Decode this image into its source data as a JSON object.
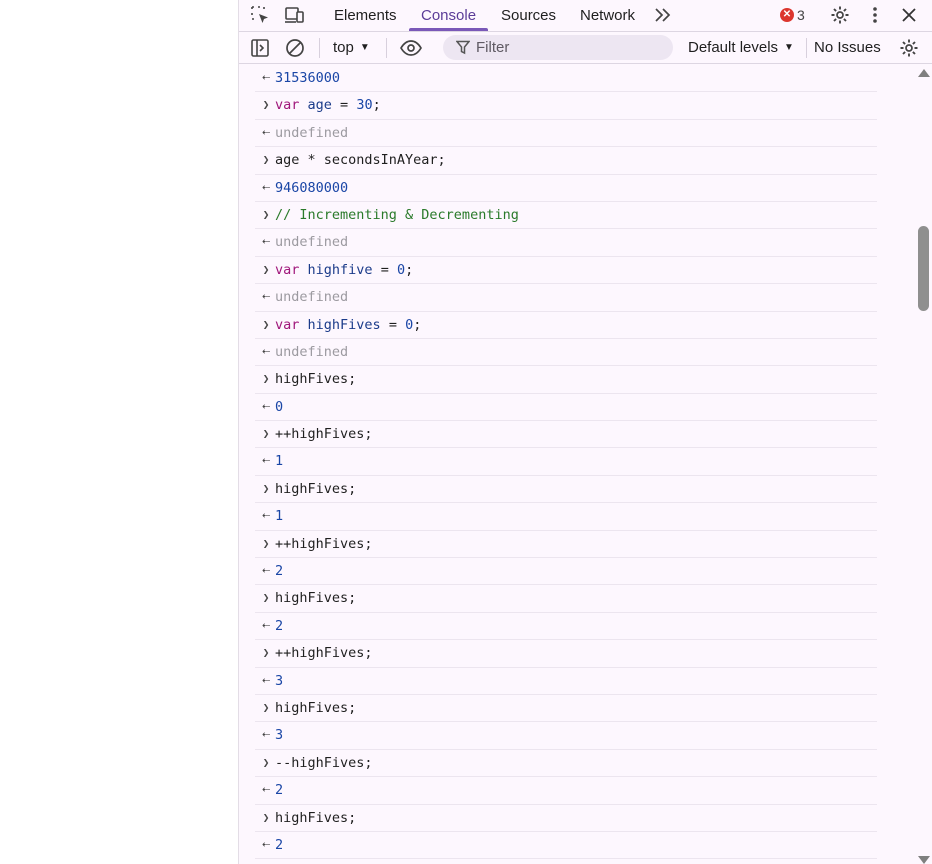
{
  "tabs": [
    {
      "label": "Elements"
    },
    {
      "label": "Console"
    },
    {
      "label": "Sources"
    },
    {
      "label": "Network"
    }
  ],
  "error_count": "3",
  "toolbar": {
    "context": "top",
    "filter_placeholder": "Filter",
    "levels": "Default levels",
    "issues": "No Issues"
  },
  "colors": {
    "accent": "#7a58b8",
    "keyword": "#a0177b",
    "number": "#1a46a6",
    "comment": "#2a7a2a",
    "undefined": "#9c9aa0",
    "error": "#dc362e"
  },
  "console": {
    "rows": [
      {
        "type": "output",
        "parts": [
          {
            "t": "31536000",
            "c": "res"
          }
        ]
      },
      {
        "type": "input",
        "parts": [
          {
            "t": "var",
            "c": "kw"
          },
          {
            "t": " ",
            "c": "plain"
          },
          {
            "t": "age",
            "c": "var"
          },
          {
            "t": " = ",
            "c": "plain"
          },
          {
            "t": "30",
            "c": "num"
          },
          {
            "t": ";",
            "c": "plain"
          }
        ]
      },
      {
        "type": "output",
        "parts": [
          {
            "t": "undefined",
            "c": "undef"
          }
        ]
      },
      {
        "type": "input",
        "parts": [
          {
            "t": "age * secondsInAYear;",
            "c": "plain"
          }
        ]
      },
      {
        "type": "output",
        "parts": [
          {
            "t": "946080000",
            "c": "res"
          }
        ]
      },
      {
        "type": "input",
        "parts": [
          {
            "t": "// Incrementing & Decrementing",
            "c": "cmt"
          }
        ]
      },
      {
        "type": "output",
        "parts": [
          {
            "t": "undefined",
            "c": "undef"
          }
        ]
      },
      {
        "type": "input",
        "parts": [
          {
            "t": "var",
            "c": "kw"
          },
          {
            "t": " ",
            "c": "plain"
          },
          {
            "t": "highfive",
            "c": "var"
          },
          {
            "t": " = ",
            "c": "plain"
          },
          {
            "t": "0",
            "c": "num"
          },
          {
            "t": ";",
            "c": "plain"
          }
        ]
      },
      {
        "type": "output",
        "parts": [
          {
            "t": "undefined",
            "c": "undef"
          }
        ]
      },
      {
        "type": "input",
        "parts": [
          {
            "t": "var",
            "c": "kw"
          },
          {
            "t": " ",
            "c": "plain"
          },
          {
            "t": "highFives",
            "c": "var"
          },
          {
            "t": " = ",
            "c": "plain"
          },
          {
            "t": "0",
            "c": "num"
          },
          {
            "t": ";",
            "c": "plain"
          }
        ]
      },
      {
        "type": "output",
        "parts": [
          {
            "t": "undefined",
            "c": "undef"
          }
        ]
      },
      {
        "type": "input",
        "parts": [
          {
            "t": "highFives;",
            "c": "plain"
          }
        ]
      },
      {
        "type": "output",
        "parts": [
          {
            "t": "0",
            "c": "res"
          }
        ]
      },
      {
        "type": "input",
        "parts": [
          {
            "t": "++highFives;",
            "c": "plain"
          }
        ]
      },
      {
        "type": "output",
        "parts": [
          {
            "t": "1",
            "c": "res"
          }
        ]
      },
      {
        "type": "input",
        "parts": [
          {
            "t": "highFives;",
            "c": "plain"
          }
        ]
      },
      {
        "type": "output",
        "parts": [
          {
            "t": "1",
            "c": "res"
          }
        ]
      },
      {
        "type": "input",
        "parts": [
          {
            "t": "++highFives;",
            "c": "plain"
          }
        ]
      },
      {
        "type": "output",
        "parts": [
          {
            "t": "2",
            "c": "res"
          }
        ]
      },
      {
        "type": "input",
        "parts": [
          {
            "t": "highFives;",
            "c": "plain"
          }
        ]
      },
      {
        "type": "output",
        "parts": [
          {
            "t": "2",
            "c": "res"
          }
        ]
      },
      {
        "type": "input",
        "parts": [
          {
            "t": "++highFives;",
            "c": "plain"
          }
        ]
      },
      {
        "type": "output",
        "parts": [
          {
            "t": "3",
            "c": "res"
          }
        ]
      },
      {
        "type": "input",
        "parts": [
          {
            "t": "highFives;",
            "c": "plain"
          }
        ]
      },
      {
        "type": "output",
        "parts": [
          {
            "t": "3",
            "c": "res"
          }
        ]
      },
      {
        "type": "input",
        "parts": [
          {
            "t": "--highFives;",
            "c": "plain"
          }
        ]
      },
      {
        "type": "output",
        "parts": [
          {
            "t": "2",
            "c": "res"
          }
        ]
      },
      {
        "type": "input",
        "parts": [
          {
            "t": "highFives;",
            "c": "plain"
          }
        ]
      },
      {
        "type": "output",
        "parts": [
          {
            "t": "2",
            "c": "res"
          }
        ]
      },
      {
        "type": "input",
        "parts": [
          {
            "t": "",
            "c": "plain"
          }
        ]
      }
    ]
  }
}
